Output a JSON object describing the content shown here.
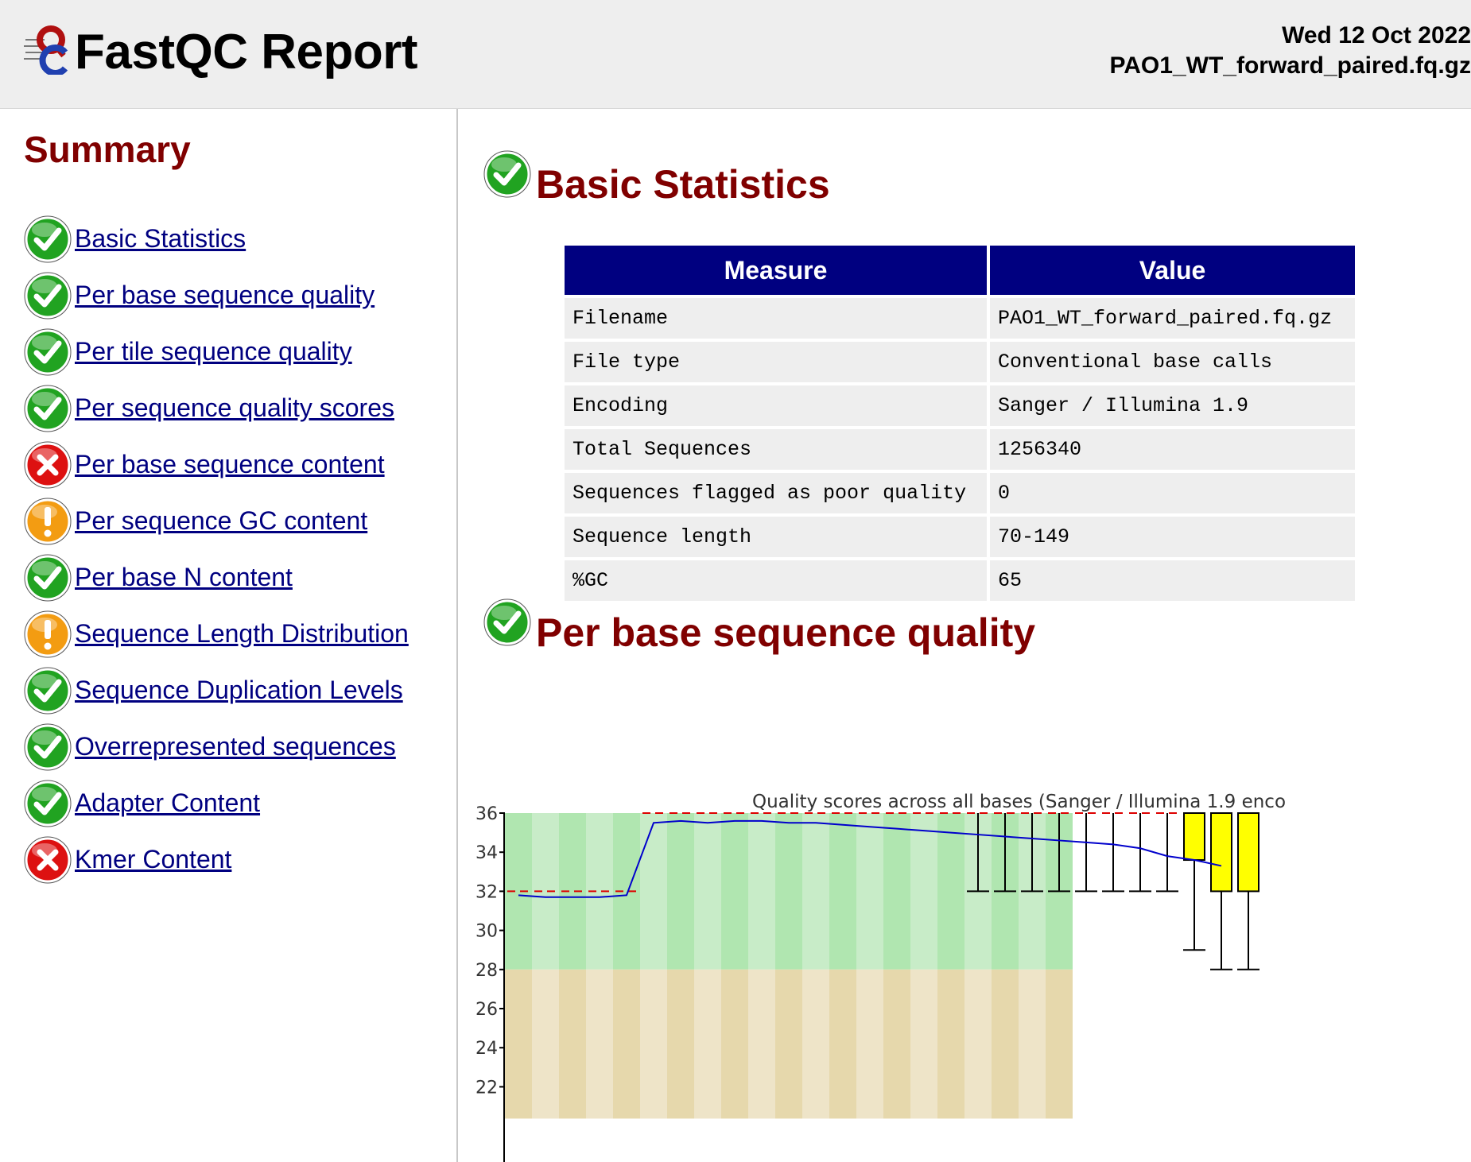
{
  "header": {
    "title": "FastQC Report",
    "date": "Wed 12 Oct 2022",
    "filename": "PAO1_WT_forward_paired.fq.gz"
  },
  "sidebar": {
    "title": "Summary",
    "items": [
      {
        "label": "Basic Statistics",
        "status": "pass"
      },
      {
        "label": "Per base sequence quality",
        "status": "pass"
      },
      {
        "label": "Per tile sequence quality",
        "status": "pass"
      },
      {
        "label": "Per sequence quality scores",
        "status": "pass"
      },
      {
        "label": "Per base sequence content",
        "status": "fail"
      },
      {
        "label": "Per sequence GC content",
        "status": "warn"
      },
      {
        "label": "Per base N content",
        "status": "pass"
      },
      {
        "label": "Sequence Length Distribution",
        "status": "warn"
      },
      {
        "label": "Sequence Duplication Levels",
        "status": "pass"
      },
      {
        "label": "Overrepresented sequences",
        "status": "pass"
      },
      {
        "label": "Adapter Content",
        "status": "pass"
      },
      {
        "label": "Kmer Content",
        "status": "fail"
      }
    ]
  },
  "basic_statistics": {
    "heading": "Basic Statistics",
    "status": "pass",
    "columns": [
      "Measure",
      "Value"
    ],
    "rows": [
      [
        "Filename",
        "PAO1_WT_forward_paired.fq.gz"
      ],
      [
        "File type",
        "Conventional base calls"
      ],
      [
        "Encoding",
        "Sanger / Illumina 1.9"
      ],
      [
        "Total Sequences",
        "1256340"
      ],
      [
        "Sequences flagged as poor quality",
        "0"
      ],
      [
        "Sequence length",
        "70-149"
      ],
      [
        "%GC",
        "65"
      ]
    ]
  },
  "per_base_quality": {
    "heading": "Per base sequence quality",
    "status": "pass"
  },
  "colors": {
    "pass": "#21a321",
    "warn": "#f39c12",
    "fail": "#dd1111",
    "heading": "#800000",
    "link": "#000080",
    "table_header": "#000080"
  },
  "chart_data": {
    "type": "box",
    "title": "Quality scores across all bases (Sanger / Illumina 1.9 enco",
    "y_ticks": [
      "36",
      "34",
      "32",
      "30",
      "28",
      "26",
      "24",
      "22"
    ],
    "ylim": [
      22,
      36
    ],
    "bands": [
      {
        "from": 28,
        "to": 36,
        "colors": [
          "#b0e6b0",
          "#c8ecc8"
        ]
      },
      {
        "from": 22,
        "to": 28,
        "colors": [
          "#e6d8ac",
          "#eee4c8"
        ]
      }
    ],
    "mean_line": [
      31.8,
      31.7,
      31.7,
      31.7,
      31.8,
      35.5,
      35.6,
      35.5,
      35.6,
      35.6,
      35.5,
      35.5,
      35.4,
      35.3,
      35.2,
      35.1,
      35.0,
      34.9,
      34.8,
      34.7,
      34.6,
      34.5,
      34.4,
      34.2,
      33.8,
      33.6,
      33.3
    ],
    "boxes": [
      {
        "low": 32,
        "q1": 32,
        "med": 36,
        "q3": 36,
        "high": 36,
        "col": 17
      },
      {
        "low": 32,
        "q1": 32,
        "med": 36,
        "q3": 36,
        "high": 36,
        "col": 18
      },
      {
        "low": 32,
        "q1": 32,
        "med": 36,
        "q3": 36,
        "high": 36,
        "col": 19
      },
      {
        "low": 32,
        "q1": 32,
        "med": 36,
        "q3": 36,
        "high": 36,
        "col": 20
      },
      {
        "low": 32,
        "q1": 32,
        "med": 36,
        "q3": 36,
        "high": 36,
        "col": 21
      },
      {
        "low": 32,
        "q1": 32,
        "med": 36,
        "q3": 36,
        "high": 36,
        "col": 22
      },
      {
        "low": 32,
        "q1": 32,
        "med": 36,
        "q3": 36,
        "high": 36,
        "col": 23
      },
      {
        "low": 32,
        "q1": 32,
        "med": 36,
        "q3": 36,
        "high": 36,
        "col": 24
      },
      {
        "low": 29,
        "q1": 33.6,
        "med": 36,
        "q3": 36,
        "high": 36,
        "col": 25,
        "fill": "#ffff00"
      },
      {
        "low": 28,
        "q1": 32,
        "med": 36,
        "q3": 36,
        "high": 36,
        "col": 26,
        "fill": "#ffff00"
      },
      {
        "low": 28,
        "q1": 32,
        "med": 36,
        "q3": 36,
        "high": 36,
        "col": 27,
        "fill": "#ffff00"
      }
    ],
    "median_dashes": [
      32,
      32,
      32,
      32,
      32,
      36,
      36,
      36,
      36,
      36,
      36,
      36,
      36,
      36,
      36,
      36,
      36,
      36,
      36,
      36,
      36,
      36,
      36,
      36,
      36,
      36,
      36
    ],
    "mean_color": "#0000cc",
    "median_color": "#dd0000"
  }
}
